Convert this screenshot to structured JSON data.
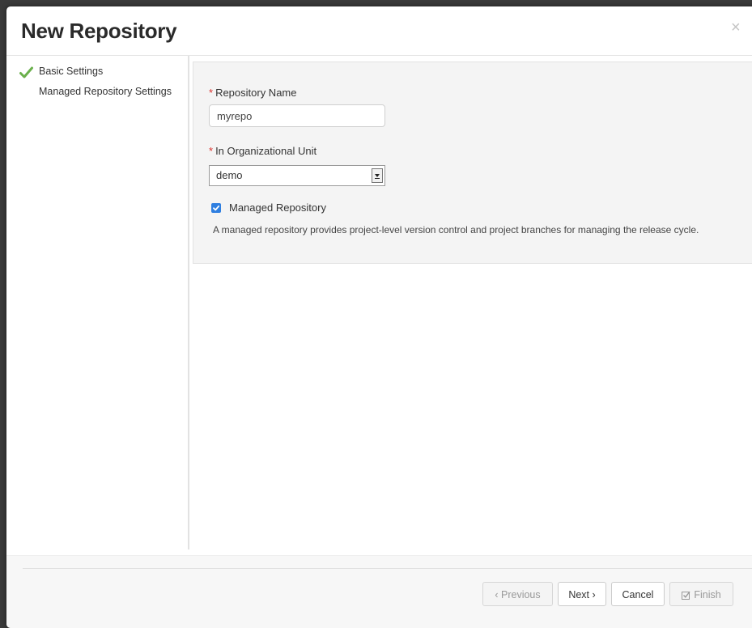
{
  "dialog": {
    "title": "New Repository",
    "close_glyph": "×"
  },
  "wizard_steps": [
    {
      "label": "Basic Settings",
      "completed": true,
      "icon": "check-icon"
    },
    {
      "label": "Managed Repository Settings",
      "completed": false
    }
  ],
  "form": {
    "required_marker": "*",
    "repository_name": {
      "label": "Repository Name",
      "value": "myrepo"
    },
    "organizational_unit": {
      "label": "In Organizational Unit",
      "selected": "demo"
    },
    "managed_repository": {
      "label": "Managed Repository",
      "checked": true,
      "help": "A managed repository provides project-level version control and project branches for managing the release cycle."
    }
  },
  "footer": {
    "previous_label": "‹ Previous",
    "next_label": "Next ›",
    "cancel_label": "Cancel",
    "finish_label": "Finish",
    "finish_icon": "check-square-icon"
  },
  "colors": {
    "check_green": "#6ab04c",
    "required_red": "#d9302c",
    "checkbox_blue": "#2f7fe0"
  }
}
